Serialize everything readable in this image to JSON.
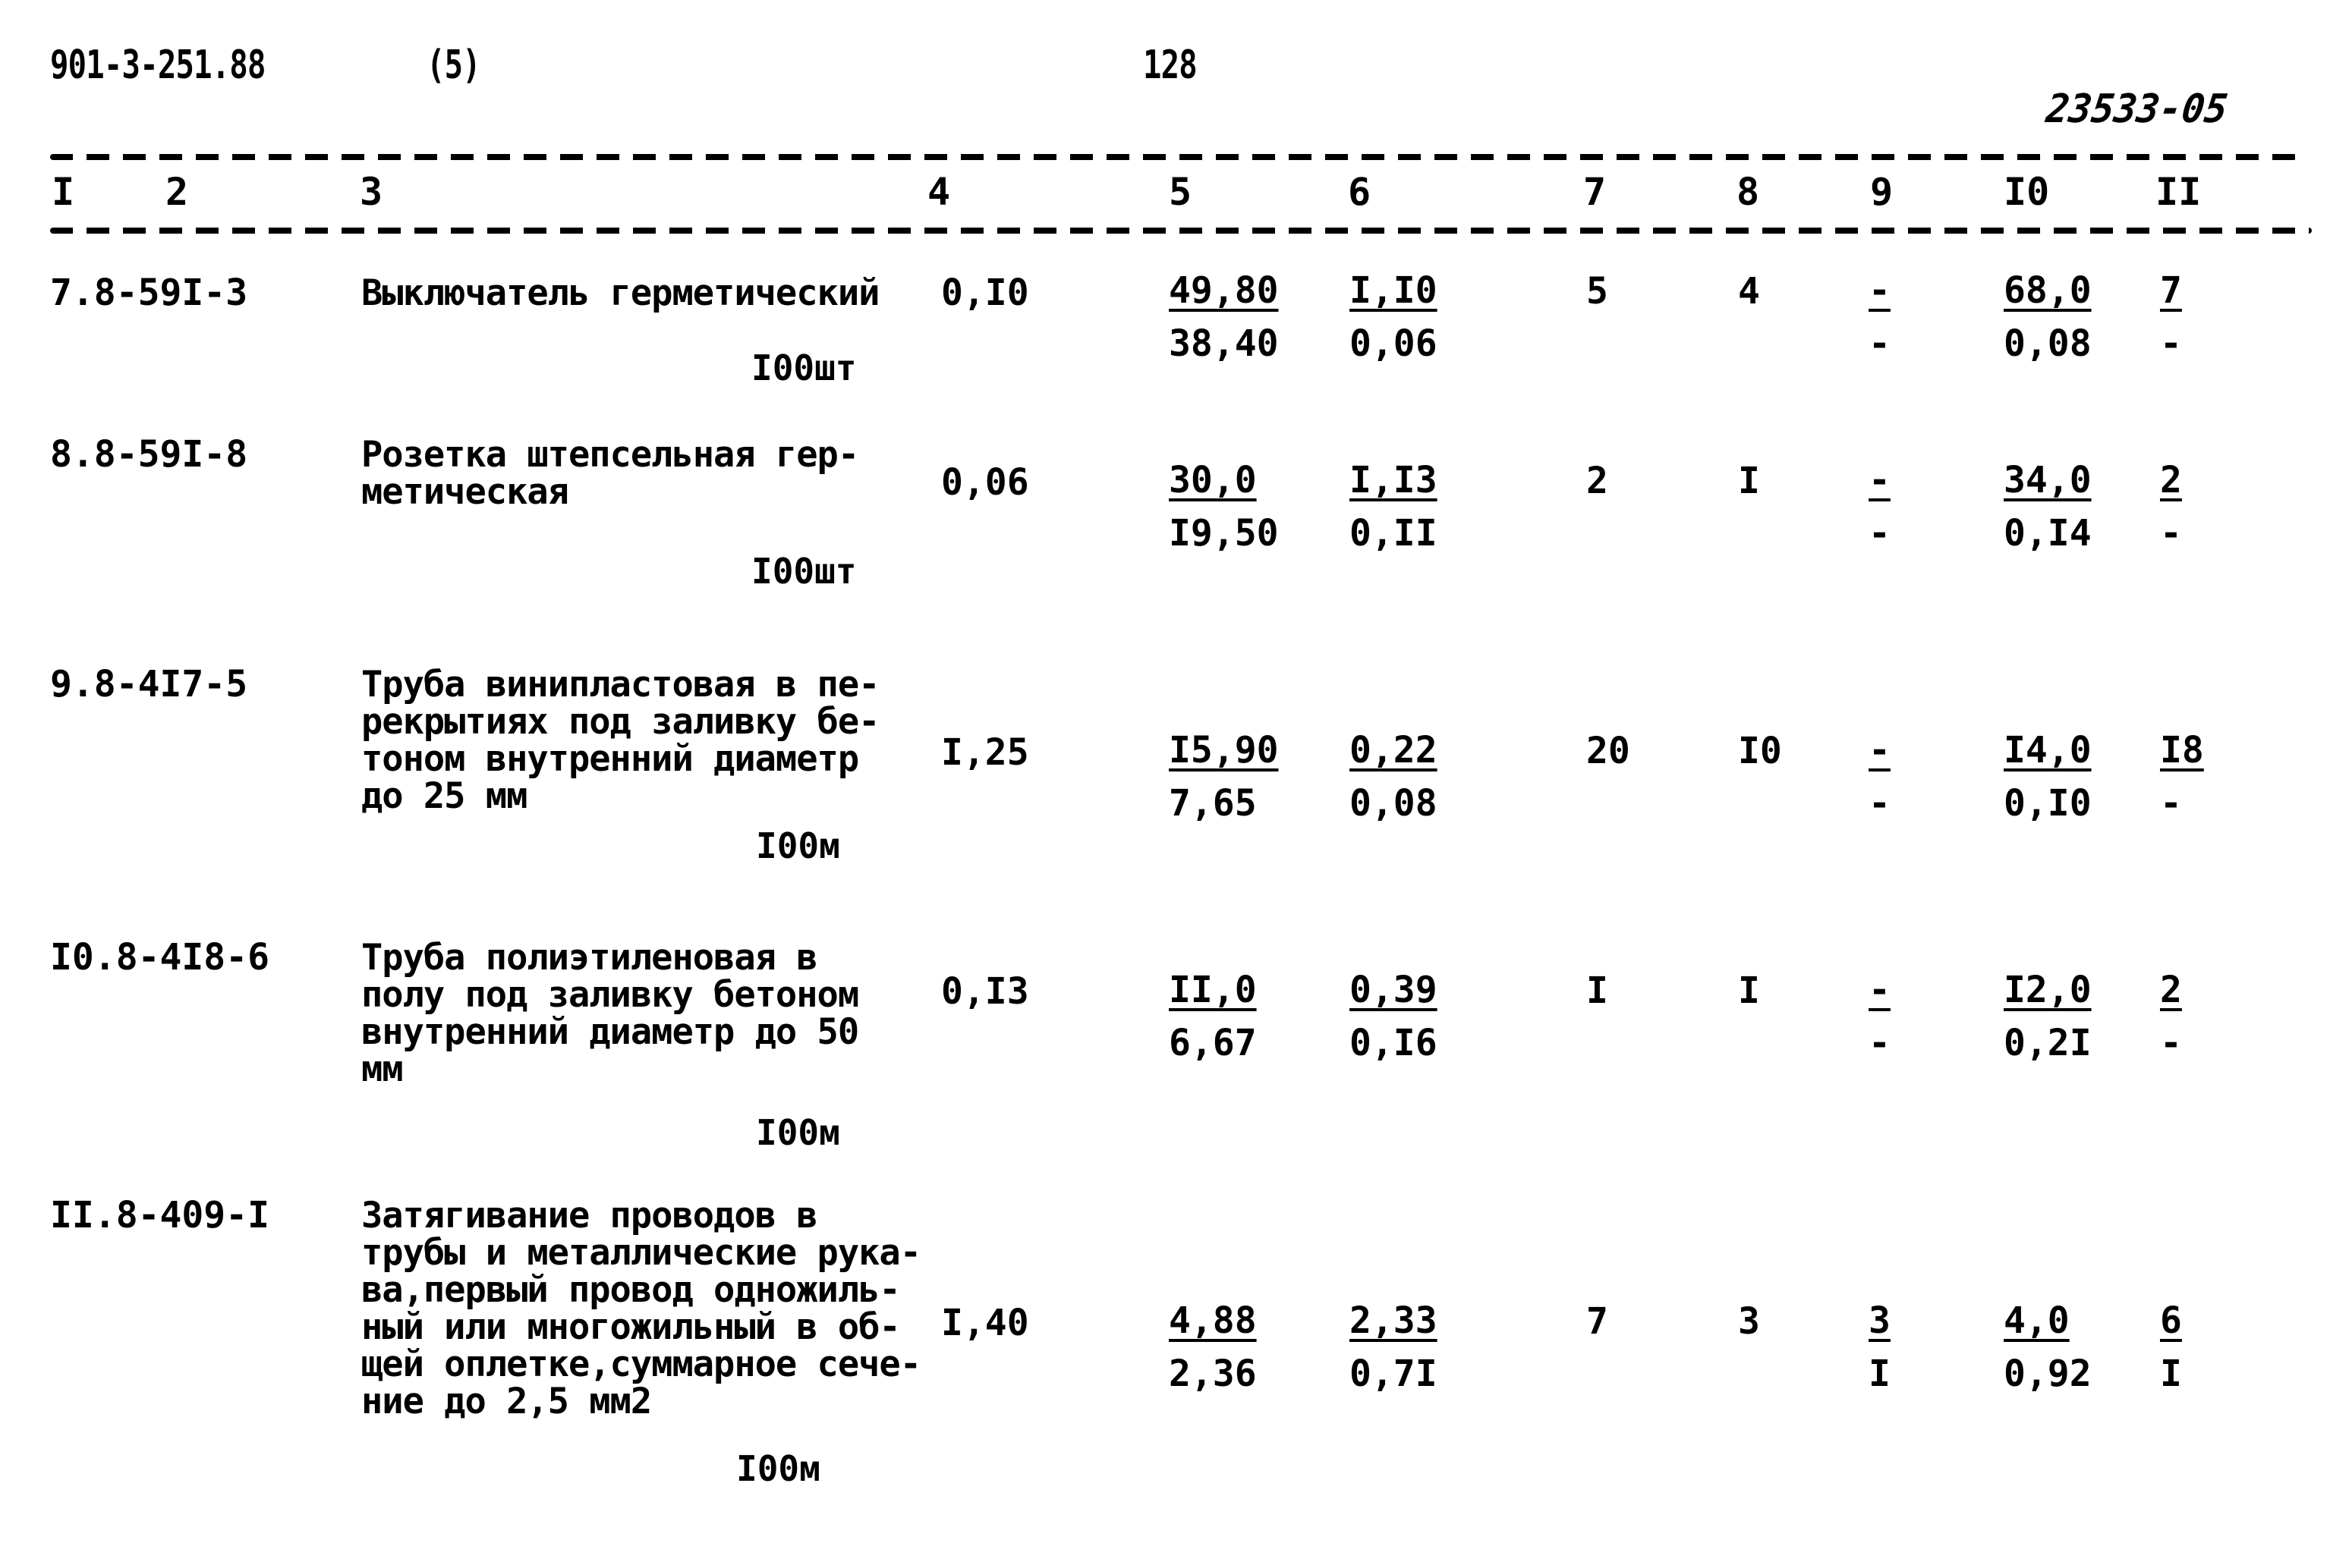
{
  "document": {
    "code": "901-3-251.88",
    "section": "(5)",
    "page_number": "128",
    "stamp": "23533-05"
  },
  "columns": [
    "I",
    "2",
    "3",
    "4",
    "5",
    "6",
    "7",
    "8",
    "9",
    "I0",
    "II"
  ],
  "rows": [
    {
      "num_code": "7.8-59I-3",
      "description": "Выключатель герметический",
      "unit": "I00шт",
      "quantity": "0,I0",
      "c5": {
        "top": "49,80",
        "bottom": "38,40"
      },
      "c6": {
        "top": "I,I0",
        "bottom": "0,06"
      },
      "c7": "5",
      "c8": "4",
      "c9": {
        "top": "-",
        "bottom": "-"
      },
      "c10": {
        "top": "68,0",
        "bottom": "0,08"
      },
      "c11": {
        "top": "7",
        "bottom": "-"
      }
    },
    {
      "num_code": "8.8-59I-8",
      "description": "Розетка штепсельная гер-\nметическая",
      "unit": "I00шт",
      "quantity": "0,06",
      "c5": {
        "top": "30,0",
        "bottom": "I9,50"
      },
      "c6": {
        "top": "I,I3",
        "bottom": "0,II"
      },
      "c7": "2",
      "c8": "I",
      "c9": {
        "top": "-",
        "bottom": "-"
      },
      "c10": {
        "top": "34,0",
        "bottom": "0,I4"
      },
      "c11": {
        "top": "2",
        "bottom": "-"
      }
    },
    {
      "num_code": "9.8-4I7-5",
      "description": "Труба винипластовая в пе-\nрекрытиях под заливку бе-\nтоном внутренний диаметр\nдо 25 мм",
      "unit": "I00м",
      "quantity": "I,25",
      "c5": {
        "top": "I5,90",
        "bottom": "7,65"
      },
      "c6": {
        "top": "0,22",
        "bottom": "0,08"
      },
      "c7": "20",
      "c8": "I0",
      "c9": {
        "top": "-",
        "bottom": "-"
      },
      "c10": {
        "top": "I4,0",
        "bottom": "0,I0"
      },
      "c11": {
        "top": "I8",
        "bottom": "-"
      }
    },
    {
      "num_code": "I0.8-4I8-6",
      "description": "Труба полиэтиленовая в\nполу под заливку бетоном\nвнутренний диаметр до 50\nмм",
      "unit": "I00м",
      "quantity": "0,I3",
      "c5": {
        "top": "II,0",
        "bottom": "6,67"
      },
      "c6": {
        "top": "0,39",
        "bottom": "0,I6"
      },
      "c7": "I",
      "c8": "I",
      "c9": {
        "top": "-",
        "bottom": "-"
      },
      "c10": {
        "top": "I2,0",
        "bottom": "0,2I"
      },
      "c11": {
        "top": "2",
        "bottom": "-"
      }
    },
    {
      "num_code": "II.8-409-I",
      "description": "Затягивание проводов в\nтрубы и металлические рука-\nва,первый провод одножиль-\nный или многожильный в об-\nщей оплетке,суммарное сече-\nние до 2,5 мм2",
      "unit": "I00м",
      "quantity": "I,40",
      "c5": {
        "top": "4,88",
        "bottom": "2,36"
      },
      "c6": {
        "top": "2,33",
        "bottom": "0,7I"
      },
      "c7": "7",
      "c8": "3",
      "c9": {
        "top": "3",
        "bottom": "I"
      },
      "c10": {
        "top": "4,0",
        "bottom": "0,92"
      },
      "c11": {
        "top": "6",
        "bottom": "I"
      }
    }
  ]
}
